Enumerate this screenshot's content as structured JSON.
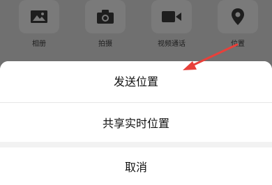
{
  "toolbar": {
    "items": [
      {
        "label": "相册",
        "icon": "photo-album-icon"
      },
      {
        "label": "拍摄",
        "icon": "camera-icon"
      },
      {
        "label": "视频通话",
        "icon": "video-call-icon"
      },
      {
        "label": "位置",
        "icon": "location-pin-icon"
      }
    ]
  },
  "sheet": {
    "send_location": "发送位置",
    "share_live_location": "共享实时位置",
    "cancel": "取消"
  },
  "colors": {
    "overlay": "#6e6e6e",
    "annotation_arrow": "#e8403a",
    "sheet_bg": "#ffffff"
  }
}
